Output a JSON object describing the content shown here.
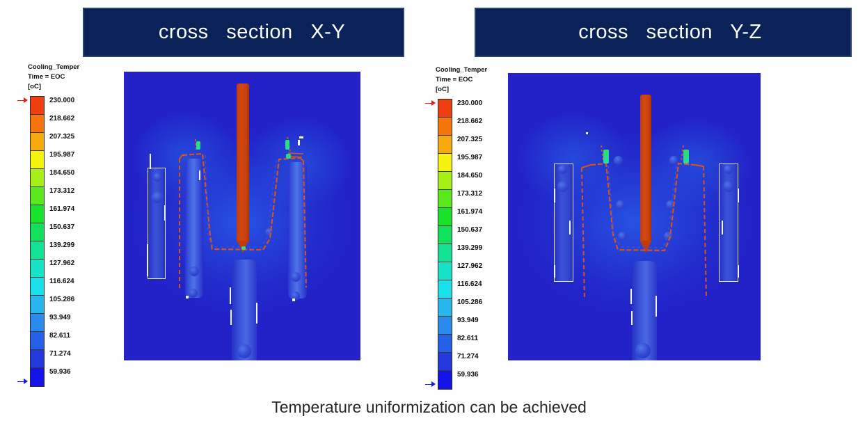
{
  "page": {
    "background": "#ffffff",
    "caption": "Temperature uniformization can be achieved"
  },
  "banners": {
    "left": {
      "title": "cross   section   X-Y",
      "bg": "#0a2257",
      "border": "#2c4470",
      "text_color": "#ffffff"
    },
    "right": {
      "title": "cross   section   Y-Z",
      "bg": "#0a2257",
      "border": "#2c4470",
      "text_color": "#ffffff"
    }
  },
  "legend": {
    "variable": "Cooling_Temper",
    "time": "Time = EOC",
    "unit": "[oC]",
    "max_arrow_color": "#e02020",
    "min_arrow_color": "#1818d8",
    "levels": [
      {
        "value": "230.000",
        "color": "#ef3f10"
      },
      {
        "value": "218.662",
        "color": "#f5740b"
      },
      {
        "value": "207.325",
        "color": "#f6a90c"
      },
      {
        "value": "195.987",
        "color": "#f6f40e"
      },
      {
        "value": "184.650",
        "color": "#a8ef18"
      },
      {
        "value": "173.312",
        "color": "#5ae81b"
      },
      {
        "value": "161.974",
        "color": "#18e22a"
      },
      {
        "value": "150.637",
        "color": "#11e05c"
      },
      {
        "value": "139.299",
        "color": "#13e196"
      },
      {
        "value": "127.962",
        "color": "#16e3c8"
      },
      {
        "value": "116.624",
        "color": "#1ae0ec"
      },
      {
        "value": "105.286",
        "color": "#28b6ef"
      },
      {
        "value": "93.949",
        "color": "#2a8bee"
      },
      {
        "value": "82.611",
        "color": "#2660e8"
      },
      {
        "value": "71.274",
        "color": "#2439dc"
      },
      {
        "value": "59.936",
        "color": "#1414e8"
      }
    ]
  },
  "panels": {
    "left": {
      "name": "cross-section-x-y",
      "field_color": "#2222c8",
      "hot_color": "#c9410e"
    },
    "right": {
      "name": "cross-section-y-z",
      "field_color": "#2222c8",
      "hot_color": "#c9410e"
    }
  },
  "chart_data": {
    "type": "heatmap",
    "title": "Cooling_Temper",
    "subtitle": "Time = EOC",
    "unit": "[oC]",
    "colorbar_min": 59.936,
    "colorbar_max": 230.0,
    "colorbar_step": 11.3376,
    "tick_labels": [
      "230.000",
      "218.662",
      "207.325",
      "195.987",
      "184.650",
      "173.312",
      "161.974",
      "150.637",
      "139.299",
      "127.962",
      "116.624",
      "105.286",
      "93.949",
      "82.611",
      "71.274",
      "59.936"
    ],
    "colors": [
      "#ef3f10",
      "#f5740b",
      "#f6a90c",
      "#f6f40e",
      "#a8ef18",
      "#5ae81b",
      "#18e22a",
      "#11e05c",
      "#13e196",
      "#16e3c8",
      "#1ae0ec",
      "#28b6ef",
      "#2a8bee",
      "#2660e8",
      "#2439dc",
      "#1414e8"
    ],
    "panels": [
      {
        "label": "cross   section   X-Y",
        "dominant_value": 60,
        "hot_feature_value": 230
      },
      {
        "label": "cross   section   Y-Z",
        "dominant_value": 60,
        "hot_feature_value": 230
      }
    ],
    "legend_position": "left-of-each-panel",
    "grid": false,
    "annotation": "Temperature uniformization can be achieved"
  }
}
